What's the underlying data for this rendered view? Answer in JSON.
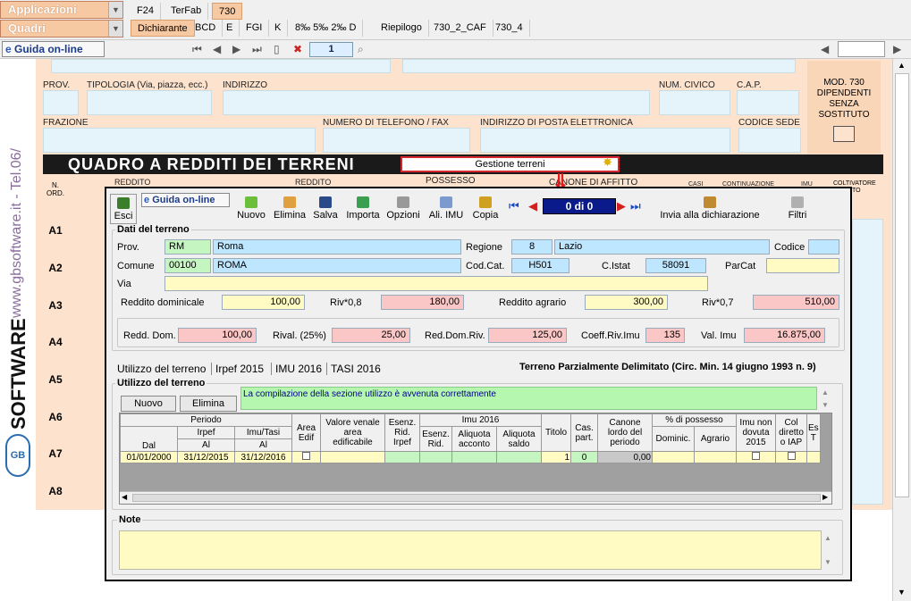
{
  "menubar": {
    "combo1": "Applicazioni",
    "combo2": "Quadri",
    "tabs_top": [
      "F24",
      "TerFab",
      "730"
    ],
    "tabs_bottom": [
      "Dichiarante",
      "BCD",
      "E",
      "FGI",
      "K",
      "8‰  5‰  2‰ D",
      "Riepilogo",
      "730_2_CAF",
      "730_4"
    ]
  },
  "navbar": {
    "guide": "Guida on-line",
    "page": "1"
  },
  "leftstrip": {
    "site": "www.gbsoftware.it - Tel.06/",
    "brand": "SOFTWARE",
    "logo": "GB"
  },
  "form": {
    "prov": "PROV.",
    "tipologia": "TIPOLOGIA (Via, piazza, ecc.)",
    "indirizzo": "INDIRIZZO",
    "civico": "NUM. CIVICO",
    "cap": "C.A.P.",
    "frazione": "FRAZIONE",
    "telefono": "NUMERO DI TELEFONO / FAX",
    "email": "INDIRIZZO DI POSTA ELETTRONICA",
    "sede": "CODICE SEDE",
    "mod730": "MOD. 730\nDIPENDENTI\nSENZA\nSOSTITUTO",
    "quadro": "QUADRO   A   REDDITI DEI TERRENI",
    "gestione": "Gestione terreni",
    "nord": "N.\nORD.",
    "col_reddito": "REDDITO",
    "col_reddito2": "REDDITO",
    "col_possesso": "POSSESSO",
    "col_canone": "CANONE DI AFFITTO",
    "col_casi": "CASI",
    "col_continuazione": "CONTINUAZIONE",
    "col_imu": "IMU",
    "col_coltivatore": "COLTIVATORE\nDIRETTO\nO IAP",
    "rows": [
      "A1",
      "A2",
      "A3",
      "A4",
      "A5",
      "A6",
      "A7",
      "A8"
    ]
  },
  "modal": {
    "toolbar": {
      "esci": "Esci",
      "guida": "Guida on-line",
      "nuovo": "Nuovo",
      "elimina": "Elimina",
      "salva": "Salva",
      "importa": "Importa",
      "opzioni": "Opzioni",
      "ali_imu": "Ali. IMU",
      "copia": "Copia",
      "counter": "0 di 0",
      "invia": "Invia alla dichiarazione",
      "filtri": "Filtri"
    },
    "dati": {
      "title": "Dati del terreno",
      "prov_label": "Prov.",
      "prov_code": "RM",
      "prov_name": "Roma",
      "regione_label": "Regione",
      "regione_code": "8",
      "regione_name": "Lazio",
      "codice_label": "Codice",
      "comune_label": "Comune",
      "comune_code": "00100",
      "comune_name": "ROMA",
      "codcat_label": "Cod.Cat.",
      "codcat": "H501",
      "cistat_label": "C.Istat",
      "cistat": "58091",
      "parcat_label": "ParCat",
      "via_label": "Via",
      "rd_label": "Reddito dominicale",
      "rd": "100,00",
      "riv08_label": "Riv*0,8",
      "riv08": "180,00",
      "ra_label": "Reddito agrario",
      "ra": "300,00",
      "riv07_label": "Riv*0,7",
      "riv07": "510,00",
      "redd_dom_label": "Redd. Dom.",
      "redd_dom": "100,00",
      "rival_label": "Rival. (25%)",
      "rival": "25,00",
      "reddomriv_label": "Red.Dom.Riv.",
      "reddomriv": "125,00",
      "coeff_label": "Coeff.Riv.Imu",
      "coeff": "135",
      "valimu_label": "Val. Imu",
      "valimu": "16.875,00"
    },
    "tabs": [
      "Utilizzo del terreno",
      "Irpef 2015",
      "IMU 2016",
      "TASI 2016"
    ],
    "delimitato": "Terreno Parzialmente Delimitato (Circ. Min. 14 giugno 1993 n. 9)",
    "utilizzo": {
      "title": "Utilizzo del terreno",
      "nuovo": "Nuovo",
      "elimina": "Elimina",
      "message": "La compilazione della sezione utilizzo è avvenuta correttamente",
      "h_periodo": "Periodo",
      "h_irpef": "Irpef",
      "h_imutasi": "Imu/Tasi",
      "h_dal": "Dal",
      "h_al": "Al",
      "h_al2": "Al",
      "h_area": "Area\nEdif",
      "h_valore": "Valore venale\narea\nedificabile",
      "h_esenz_irpef": "Esenz.\nRid.\nIrpef",
      "h_imu2016": "Imu 2016",
      "h_esenz_rid": "Esenz.\nRid.",
      "h_aliq_acc": "Aliquota\nacconto",
      "h_aliq_saldo": "Aliquota\nsaldo",
      "h_titolo": "Titolo",
      "h_cas": "Cas.\npart.",
      "h_canone": "Canone\nlordo del\nperiodo",
      "h_possesso": "% di possesso",
      "h_dominic": "Dominic.",
      "h_agrario": "Agrario",
      "h_imunon": "Imu non\ndovuta\n2015",
      "h_col": "Col\ndiretto\no IAP",
      "h_es": "Es\nT",
      "row": {
        "dal": "01/01/2000",
        "al_irpef": "31/12/2015",
        "al_imu": "31/12/2016",
        "titolo": "1",
        "cas": "0",
        "canone": "0,00"
      }
    },
    "note": {
      "title": "Note"
    }
  }
}
